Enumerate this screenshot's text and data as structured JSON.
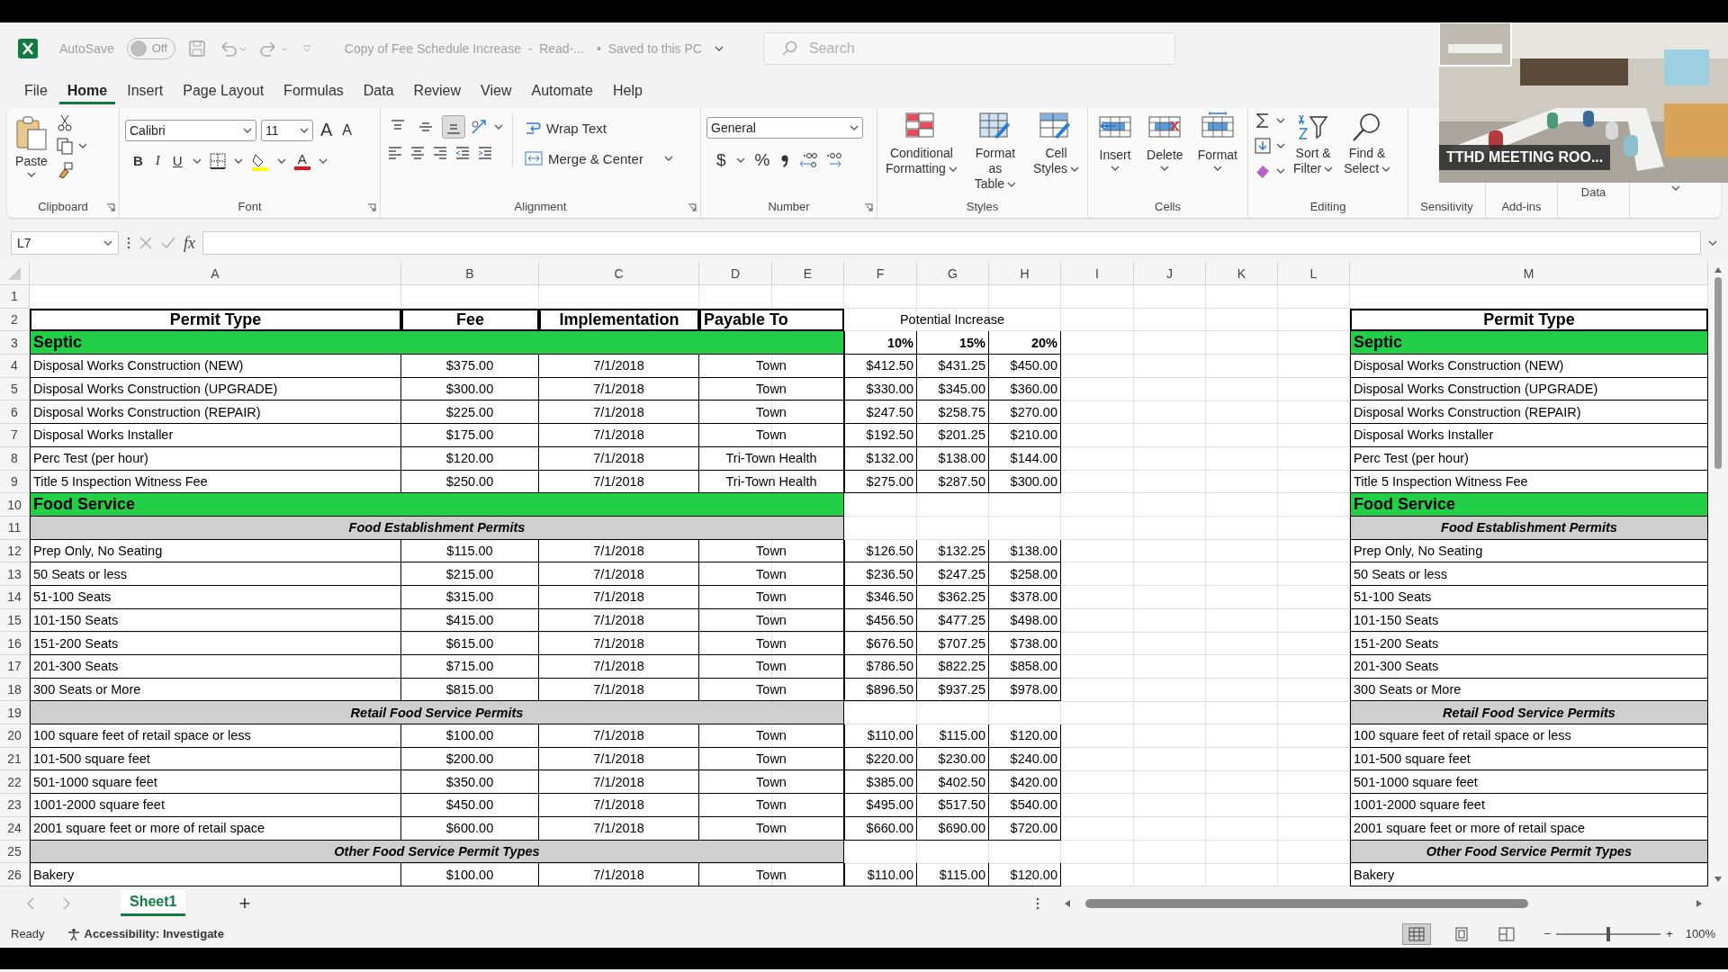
{
  "title_bar": {
    "autosave_label": "AutoSave",
    "autosave_on": false,
    "autosave_state": "Off",
    "document_title": "Copy of Fee Schedule Increase  -  Read-...",
    "save_status": "•  Saved to this PC",
    "search_placeholder": "Search"
  },
  "menu_tabs": [
    {
      "label": "File",
      "selected": false
    },
    {
      "label": "Home",
      "selected": true
    },
    {
      "label": "Insert",
      "selected": false
    },
    {
      "label": "Page Layout",
      "selected": false
    },
    {
      "label": "Formulas",
      "selected": false
    },
    {
      "label": "Data",
      "selected": false
    },
    {
      "label": "Review",
      "selected": false
    },
    {
      "label": "View",
      "selected": false
    },
    {
      "label": "Automate",
      "selected": false
    },
    {
      "label": "Help",
      "selected": false
    }
  ],
  "ribbon": {
    "clipboard": {
      "paste": "Paste",
      "label": "Clipboard"
    },
    "font": {
      "name": "Calibri",
      "size": "11",
      "grow": "A",
      "shrink": "A",
      "bold": "B",
      "italic": "I",
      "underline": "U",
      "font_color": "A",
      "label": "Font"
    },
    "alignment": {
      "vertical": [
        {
          "selected": false
        },
        {
          "selected": false
        },
        {
          "selected": true
        }
      ],
      "wrap_text": "Wrap Text",
      "merge_center": "Merge & Center",
      "label": "Alignment"
    },
    "number": {
      "format": "General",
      "currency": "$",
      "percent": "%",
      "label": "Number"
    },
    "styles": {
      "buttons": [
        [
          "Conditional",
          "Formatting"
        ],
        [
          "Format as",
          "Table"
        ],
        [
          "Cell",
          "Styles"
        ]
      ],
      "label": "Styles"
    },
    "cells": {
      "buttons": [
        "Insert",
        "Delete",
        "Format"
      ],
      "label": "Cells"
    },
    "editing": {
      "buttons": [
        [
          "Sort &",
          "Filter"
        ],
        [
          "Find &",
          "Select"
        ]
      ],
      "label": "Editing"
    },
    "extra_groups": [
      "Sensitivity",
      "Add-ins",
      "Data"
    ]
  },
  "formula_bar": {
    "name_box": "L7",
    "function_label": "fx"
  },
  "sheet": {
    "columns": [
      "A",
      "B",
      "C",
      "D",
      "E",
      "F",
      "G",
      "H",
      "I",
      "J",
      "K",
      "L",
      "M"
    ],
    "rows": [
      {
        "number": "1",
        "kind": "blank"
      },
      {
        "number": "2",
        "kind": "header",
        "permit_type": "Permit Type",
        "fee": "Fee",
        "implementation": "Implementation",
        "payable_to": "Payable To",
        "increase_label": "Potential Increase",
        "copy": "Permit Type"
      },
      {
        "number": "3",
        "kind": "section",
        "label": "Septic",
        "increases": [
          "10%",
          "15%",
          "20%"
        ],
        "copy": "Septic"
      },
      {
        "number": "4",
        "kind": "item",
        "permit_type": "Disposal Works Construction (NEW)",
        "fee": "$375.00",
        "implementation": "7/1/2018",
        "payable_to": "Town",
        "increases": [
          "$412.50",
          "$431.25",
          "$450.00"
        ],
        "copy": "Disposal Works Construction (NEW)"
      },
      {
        "number": "5",
        "kind": "item",
        "permit_type": "Disposal Works Construction (UPGRADE)",
        "fee": "$300.00",
        "implementation": "7/1/2018",
        "payable_to": "Town",
        "increases": [
          "$330.00",
          "$345.00",
          "$360.00"
        ],
        "copy": "Disposal Works Construction (UPGRADE)"
      },
      {
        "number": "6",
        "kind": "item",
        "permit_type": "Disposal Works Construction (REPAIR)",
        "fee": "$225.00",
        "implementation": "7/1/2018",
        "payable_to": "Town",
        "increases": [
          "$247.50",
          "$258.75",
          "$270.00"
        ],
        "copy": "Disposal Works Construction (REPAIR)"
      },
      {
        "number": "7",
        "kind": "item",
        "permit_type": "Disposal Works Installer",
        "fee": "$175.00",
        "implementation": "7/1/2018",
        "payable_to": "Town",
        "increases": [
          "$192.50",
          "$201.25",
          "$210.00"
        ],
        "copy": "Disposal Works Installer"
      },
      {
        "number": "8",
        "kind": "item",
        "permit_type": "Perc Test (per hour)",
        "fee": "$120.00",
        "implementation": "7/1/2018",
        "payable_to": "Tri-Town Health",
        "increases": [
          "$132.00",
          "$138.00",
          "$144.00"
        ],
        "copy": "Perc Test (per hour)"
      },
      {
        "number": "9",
        "kind": "item",
        "permit_type": "Title 5 Inspection Witness Fee",
        "fee": "$250.00",
        "implementation": "7/1/2018",
        "payable_to": "Tri-Town Health",
        "increases": [
          "$275.00",
          "$287.50",
          "$300.00"
        ],
        "copy": "Title 5 Inspection Witness Fee"
      },
      {
        "number": "10",
        "kind": "section",
        "label": "Food Service",
        "copy": "Food Service"
      },
      {
        "number": "11",
        "kind": "subsection",
        "label": "Food Establishment Permits",
        "copy": "Food Establishment Permits"
      },
      {
        "number": "12",
        "kind": "item",
        "permit_type": "Prep Only, No Seating",
        "fee": "$115.00",
        "implementation": "7/1/2018",
        "payable_to": "Town",
        "increases": [
          "$126.50",
          "$132.25",
          "$138.00"
        ],
        "copy": "Prep Only, No Seating"
      },
      {
        "number": "13",
        "kind": "item",
        "permit_type": "50 Seats or less",
        "fee": "$215.00",
        "implementation": "7/1/2018",
        "payable_to": "Town",
        "increases": [
          "$236.50",
          "$247.25",
          "$258.00"
        ],
        "copy": "50 Seats or less"
      },
      {
        "number": "14",
        "kind": "item",
        "permit_type": "51-100 Seats",
        "fee": "$315.00",
        "implementation": "7/1/2018",
        "payable_to": "Town",
        "increases": [
          "$346.50",
          "$362.25",
          "$378.00"
        ],
        "copy": "51-100 Seats"
      },
      {
        "number": "15",
        "kind": "item",
        "permit_type": "101-150 Seats",
        "fee": "$415.00",
        "implementation": "7/1/2018",
        "payable_to": "Town",
        "increases": [
          "$456.50",
          "$477.25",
          "$498.00"
        ],
        "copy": "101-150 Seats"
      },
      {
        "number": "16",
        "kind": "item",
        "permit_type": "151-200 Seats",
        "fee": "$615.00",
        "implementation": "7/1/2018",
        "payable_to": "Town",
        "increases": [
          "$676.50",
          "$707.25",
          "$738.00"
        ],
        "copy": "151-200 Seats"
      },
      {
        "number": "17",
        "kind": "item",
        "permit_type": "201-300 Seats",
        "fee": "$715.00",
        "implementation": "7/1/2018",
        "payable_to": "Town",
        "increases": [
          "$786.50",
          "$822.25",
          "$858.00"
        ],
        "copy": "201-300 Seats"
      },
      {
        "number": "18",
        "kind": "item",
        "permit_type": "300 Seats or More",
        "fee": "$815.00",
        "implementation": "7/1/2018",
        "payable_to": "Town",
        "increases": [
          "$896.50",
          "$937.25",
          "$978.00"
        ],
        "copy": "300 Seats or More"
      },
      {
        "number": "19",
        "kind": "subsection",
        "label": "Retail Food Service Permits",
        "copy": "Retail Food Service Permits"
      },
      {
        "number": "20",
        "kind": "item",
        "permit_type": "100 square feet of retail space or less",
        "fee": "$100.00",
        "implementation": "7/1/2018",
        "payable_to": "Town",
        "increases": [
          "$110.00",
          "$115.00",
          "$120.00"
        ],
        "copy": "100 square feet of retail space or less"
      },
      {
        "number": "21",
        "kind": "item",
        "permit_type": "101-500 square feet",
        "fee": "$200.00",
        "implementation": "7/1/2018",
        "payable_to": "Town",
        "increases": [
          "$220.00",
          "$230.00",
          "$240.00"
        ],
        "copy": "101-500 square feet"
      },
      {
        "number": "22",
        "kind": "item",
        "permit_type": "501-1000 square feet",
        "fee": "$350.00",
        "implementation": "7/1/2018",
        "payable_to": "Town",
        "increases": [
          "$385.00",
          "$402.50",
          "$420.00"
        ],
        "copy": "501-1000 square feet"
      },
      {
        "number": "23",
        "kind": "item",
        "permit_type": "1001-2000 square feet",
        "fee": "$450.00",
        "implementation": "7/1/2018",
        "payable_to": "Town",
        "increases": [
          "$495.00",
          "$517.50",
          "$540.00"
        ],
        "copy": "1001-2000 square feet"
      },
      {
        "number": "24",
        "kind": "item",
        "permit_type": "2001 square feet or more of retail space",
        "fee": "$600.00",
        "implementation": "7/1/2018",
        "payable_to": "Town",
        "increases": [
          "$660.00",
          "$690.00",
          "$720.00"
        ],
        "copy": "2001 square feet or more of retail space"
      },
      {
        "number": "25",
        "kind": "subsection",
        "label": "Other Food Service Permit Types",
        "copy": "Other Food Service Permit Types"
      },
      {
        "number": "26",
        "kind": "item",
        "permit_type": "Bakery",
        "fee": "$100.00",
        "implementation": "7/1/2018",
        "payable_to": "Town",
        "increases": [
          "$110.00",
          "$115.00",
          "$120.00"
        ],
        "copy": "Bakery"
      }
    ]
  },
  "sheet_tabs": [
    {
      "label": "Sheet1",
      "selected": true
    }
  ],
  "add_sheet": "+",
  "status_bar": {
    "ready": "Ready",
    "accessibility": "Accessibility: Investigate",
    "views": [
      {
        "kind": "normal",
        "selected": true
      },
      {
        "kind": "page_layout",
        "selected": false
      },
      {
        "kind": "page_break",
        "selected": false
      }
    ],
    "zoom_slider": {
      "level": 0.5
    },
    "zoom_out": "−",
    "zoom_in": "+",
    "zoom": "100%"
  },
  "video_overlay": {
    "caption": "TTHD MEETING ROO..."
  }
}
